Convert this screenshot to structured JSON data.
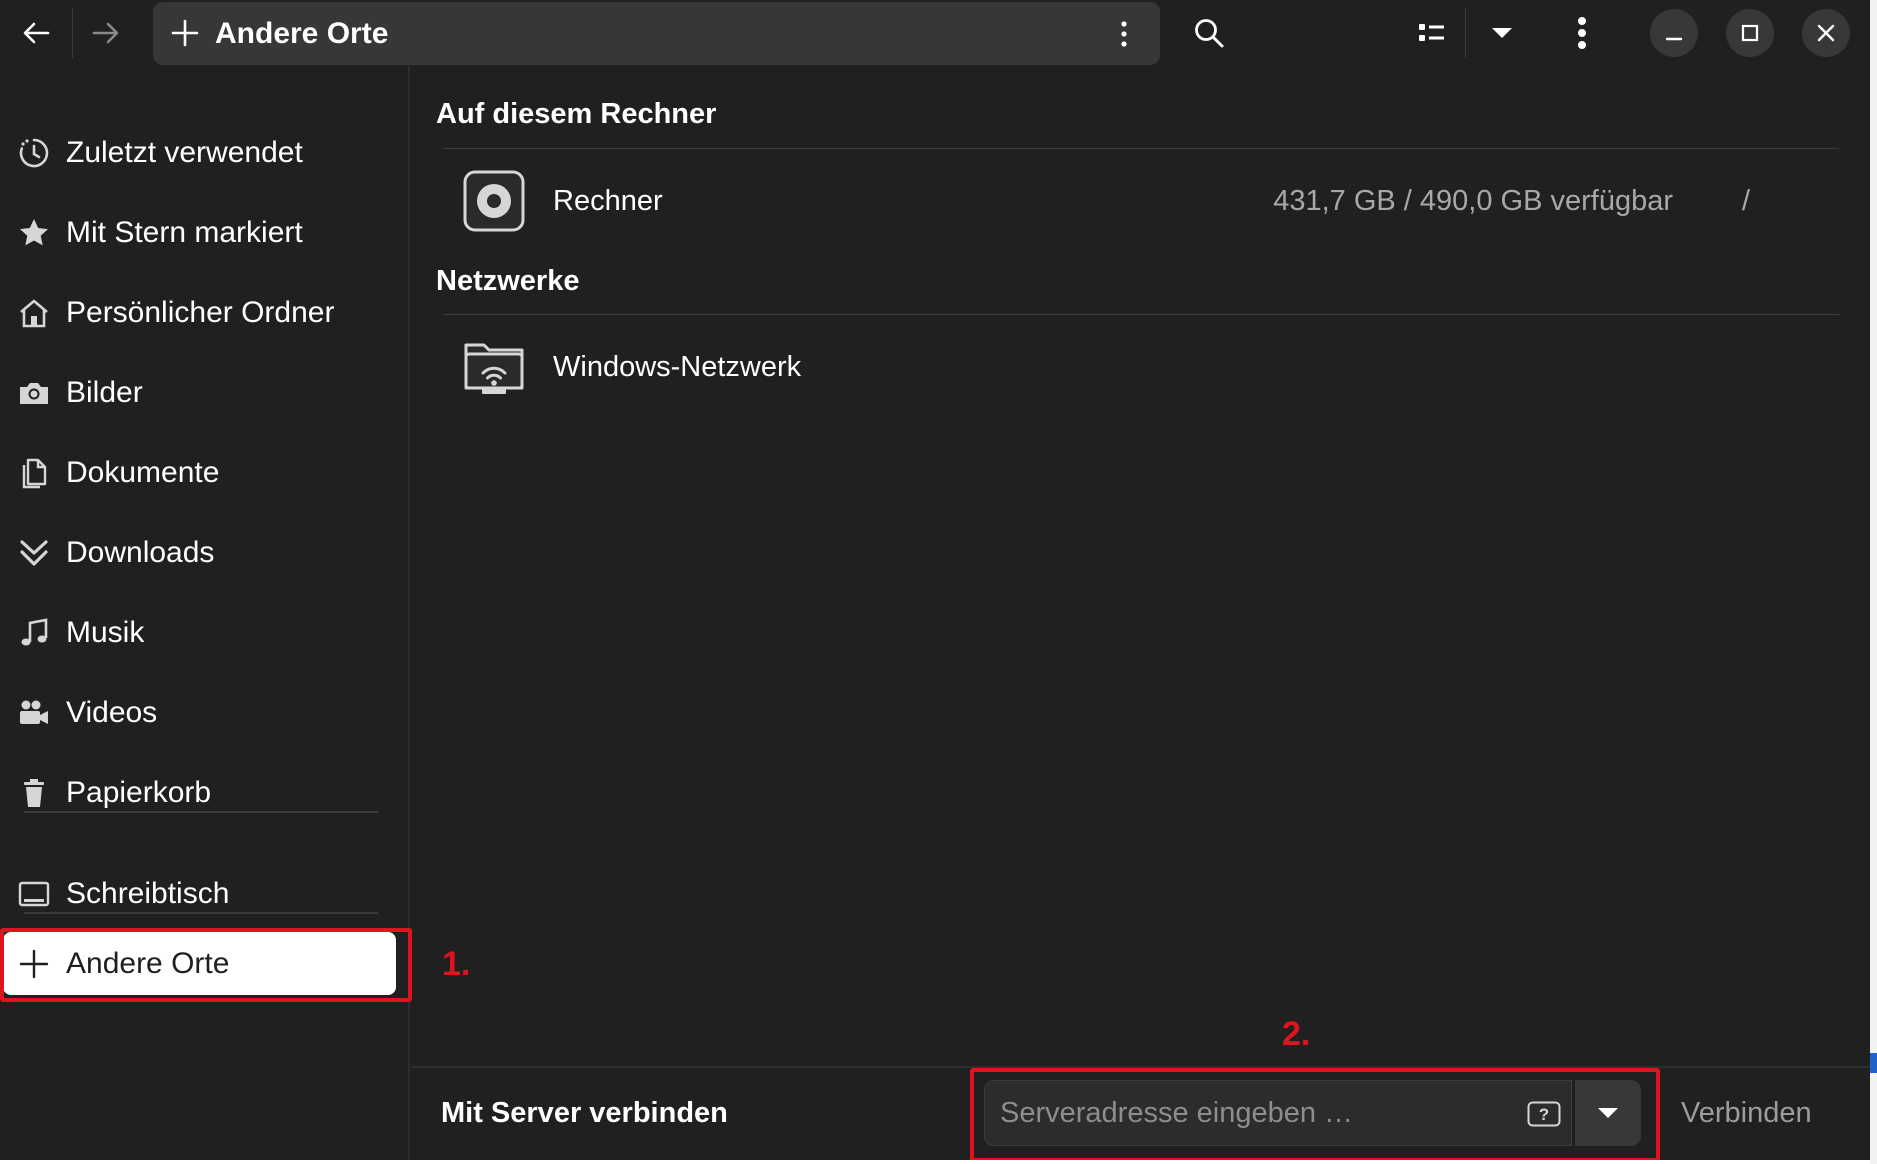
{
  "header": {
    "back_icon": "arrow-left-icon",
    "forward_icon": "arrow-right-icon",
    "path_icon": "plus-icon",
    "path_label": "Andere Orte",
    "path_menu_icon": "kebab-vertical-icon",
    "search_icon": "search-icon",
    "view_icon": "list-view-icon",
    "view_dropdown_icon": "caret-down-icon",
    "main_menu_icon": "kebab-vertical-icon",
    "minimize_icon": "minimize-icon",
    "maximize_icon": "maximize-icon",
    "close_icon": "close-icon"
  },
  "sidebar": {
    "items": [
      {
        "label": "Zuletzt verwendet",
        "icon": "recent-icon"
      },
      {
        "label": "Mit Stern markiert",
        "icon": "star-icon"
      },
      {
        "label": "Persönlicher Ordner",
        "icon": "home-icon"
      },
      {
        "label": "Bilder",
        "icon": "camera-icon"
      },
      {
        "label": "Dokumente",
        "icon": "documents-icon"
      },
      {
        "label": "Downloads",
        "icon": "downloads-icon"
      },
      {
        "label": "Musik",
        "icon": "music-icon"
      },
      {
        "label": "Videos",
        "icon": "video-camera-icon"
      },
      {
        "label": "Papierkorb",
        "icon": "trash-icon"
      }
    ],
    "desktop": {
      "label": "Schreibtisch",
      "icon": "desktop-icon"
    },
    "other_places": {
      "label": "Andere Orte",
      "icon": "plus-icon"
    }
  },
  "main": {
    "section_computer": "Auf diesem Rechner",
    "computer_row": {
      "label": "Rechner",
      "info": "431,7 GB / 490,0 GB verfügbar",
      "path": "/",
      "icon": "drive-icon"
    },
    "section_networks": "Netzwerke",
    "network_row": {
      "label": "Windows-Netzwerk",
      "icon": "network-folder-icon"
    }
  },
  "bottom": {
    "title": "Mit Server verbinden",
    "input_placeholder": "Serveradresse eingeben …",
    "input_value": "",
    "help_icon": "help-icon",
    "dropdown_icon": "caret-down-icon",
    "connect_label": "Verbinden"
  },
  "annotations": {
    "marker_1": "1.",
    "marker_2": "2."
  },
  "colors": {
    "background": "#202020",
    "pathbar": "#373737",
    "highlight": "#e0141e",
    "active_item_bg": "#ffffff",
    "secondary_text": "#a8a8a8"
  }
}
